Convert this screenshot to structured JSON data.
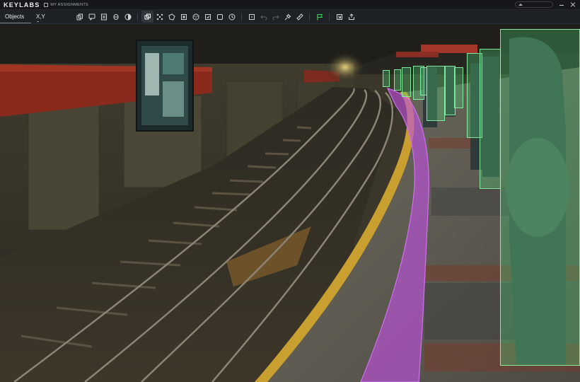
{
  "app": {
    "brand": "KEYLABS",
    "assignments_label": "MY ASSIGNMENTS"
  },
  "tabs": [
    {
      "label": "Objects"
    },
    {
      "label": "X,Y"
    }
  ],
  "toolbar_icons": [
    "copy-icon",
    "comment-icon",
    "notes-icon",
    "attribute-icon",
    "contrast-icon",
    "layers-icon",
    "move-points-icon",
    "polygon-icon",
    "brush-icon",
    "group-icon",
    "cuboid-icon",
    "frame-icon",
    "history-icon",
    "select-icon",
    "undo-icon",
    "redo-icon",
    "pin-icon",
    "measure-icon",
    "flag-icon",
    "export-icon",
    "share-icon"
  ],
  "colors": {
    "bbox_fill": "#4cd07a",
    "bbox_stroke": "#8cffaa",
    "polygon_fill": "#c050e0",
    "flag": "#3ecf5a",
    "toolbar_bg": "#1e2126"
  },
  "annotations": {
    "polygon_count": 1,
    "bbox_count": 11
  }
}
